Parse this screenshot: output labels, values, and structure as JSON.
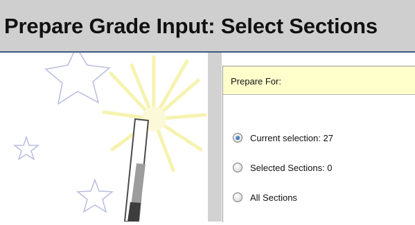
{
  "page": {
    "title": "Prepare Grade Input: Select Sections"
  },
  "prepare_panel": {
    "header_label": "Prepare For:",
    "options": [
      {
        "label": "Current selection: 27",
        "checked": true
      },
      {
        "label": "Selected Sections: 0",
        "checked": false
      },
      {
        "label": "All Sections",
        "checked": false
      }
    ]
  },
  "colors": {
    "header_bg": "#cfcfcf",
    "header_rule": "#3d5a80",
    "panel_header_bg": "#ffffcc",
    "radio_selected": "#1d5fa8"
  },
  "icons": {
    "wizard_art": "magic-wand-illustration"
  }
}
